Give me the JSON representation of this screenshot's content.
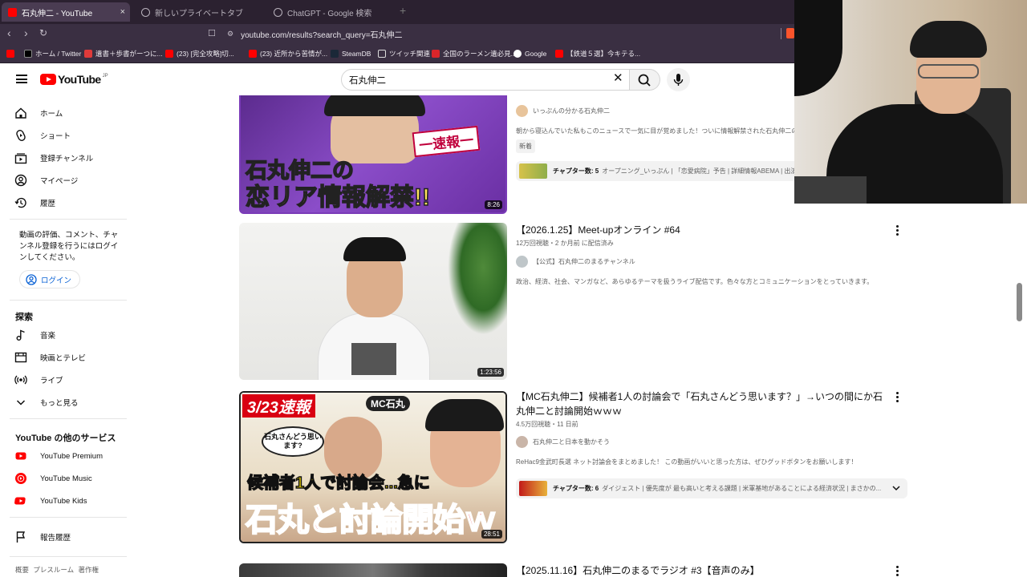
{
  "browser": {
    "tabs": [
      {
        "title": "石丸伸二 - YouTube",
        "active": true
      },
      {
        "title": "新しいプライベートタブ",
        "active": false
      },
      {
        "title": "ChatGPT - Google 検索",
        "active": false
      }
    ],
    "close_glyph": "×",
    "new_tab_glyph": "+",
    "url": "youtube.com/results?search_query=石丸伸二",
    "bookmarks": [
      "ホーム / Twitter",
      "遺書＋歩書がーつに...",
      "(23) [完全攻略]切...",
      "(23) 近所から苦情が...",
      "SteamDB",
      "ツイッチ関連",
      "全国のラーメン遺必見...",
      "Google",
      "【鉄道５選】今キテる..."
    ]
  },
  "youtube": {
    "logo_text": "YouTube",
    "logo_region": "JP",
    "search_value": "石丸伸二",
    "clear_glyph": "✕",
    "sidebar": {
      "main": [
        "ホーム",
        "ショート",
        "登録チャンネル",
        "マイページ",
        "履歴"
      ],
      "login_prompt": "動画の評価、コメント、チャンネル登録を行うにはログインしてください。",
      "login_label": "ログイン",
      "explore_header": "探索",
      "explore": [
        "音楽",
        "映画とテレビ",
        "ライブ",
        "もっと見る"
      ],
      "services_header": "YouTube の他のサービス",
      "services": [
        "YouTube Premium",
        "YouTube Music",
        "YouTube Kids"
      ],
      "report": "報告履歴",
      "footer": "概要 プレスルーム 著作権"
    },
    "results": [
      {
        "thumb_text_1": "石丸伸二の",
        "thumb_text_2": "恋リア情報解禁!!",
        "thumb_badge": "一速報一",
        "duration": "8:26",
        "channel": "いっぷんの分かる石丸伸二",
        "description": "朝から寝込んでいた私もこのニュースで一気に目が覚めました！ついに情報解禁された石丸伸二の",
        "badge": "新着",
        "chapters_label": "チャプター数: 5",
        "chapters_text": "オープニング_いっぷん | 「恋愛病院」予告 | 詳細情報ABEMA | 出演"
      },
      {
        "title": "【2026.1.25】Meet-upオンライン #64",
        "meta": "12万回視聴・2 か月前 に配信済み",
        "duration": "1:23:56",
        "channel": "【公式】石丸伸二のまるチャンネル",
        "description": "政治、経済、社会、マンガなど、あらゆるテーマを扱うライブ配信です。色々な方とコミュニケーションをとっていきます。"
      },
      {
        "title": "【MC石丸伸二】候補者1人の討論会で「石丸さんどう思います？」→いつの間にか石丸伸二と討論開始ｗｗｗ",
        "meta": "4.5万回視聴・11 日前",
        "duration": "28:51",
        "thumb_text_date": "3/23速報",
        "thumb_text_mc": "MC石丸",
        "thumb_bubble": "石丸さんどう思います?",
        "thumb_text_3": "候補者1人で討論会...急に",
        "thumb_text_4": "石丸と討論開始ｗ",
        "channel": "石丸伸二と日本を動かそう",
        "description": "ReHac9金武町長選 ネット討論会をまとめました！ この動画がいいと思った方は、ぜひグッドボタンをお願いします！",
        "chapters_label": "チャプター数: 6",
        "chapters_text": "ダイジェスト | 優先度が 最も高いと考える課題 | 米軍基地があることによる経済状況 | まさかの..."
      },
      {
        "title": "【2025.11.16】石丸伸二のまるでラジオ #3【音声のみ】"
      }
    ]
  },
  "colors": {
    "yt_red": "#ff0000",
    "link_blue": "#065fd4",
    "browser_bg": "#2b2130"
  }
}
